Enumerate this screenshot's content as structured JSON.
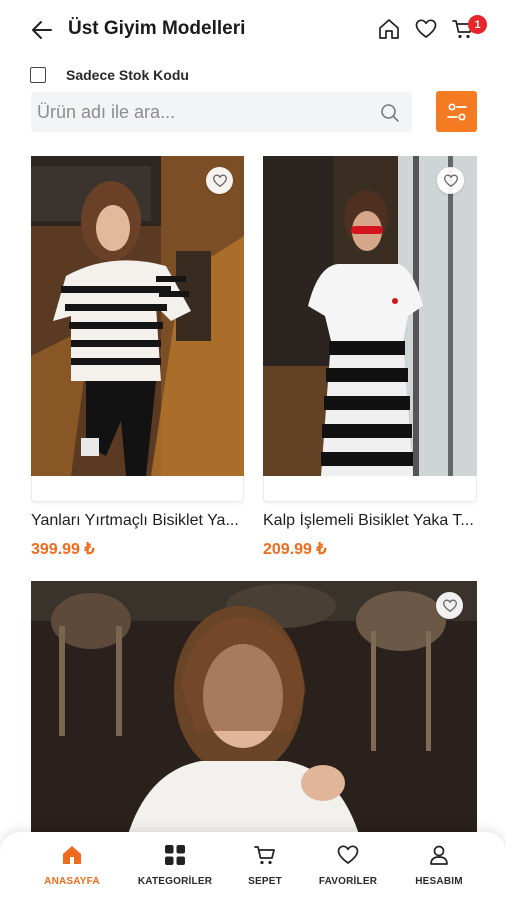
{
  "header": {
    "title": "Üst Giyim Modelleri",
    "cart_count": "1"
  },
  "filters": {
    "stock_code_label": "Sadece Stok Kodu"
  },
  "search": {
    "placeholder": "Ürün adı ile ara...",
    "value": ""
  },
  "products": [
    {
      "name": "Yanları Yırtmaçlı Bisiklet Yaka Kazak",
      "price": "399.99 ₺"
    },
    {
      "name": "Kalp İşlemeli Bisiklet Yaka Tişört",
      "price": "209.99 ₺"
    },
    {
      "name": "",
      "price": ""
    }
  ],
  "bottom_nav": {
    "items": [
      {
        "label": "ANASAYFA",
        "icon": "home-icon",
        "active": true
      },
      {
        "label": "KATEGORİLER",
        "icon": "grid-icon",
        "active": false
      },
      {
        "label": "SEPET",
        "icon": "cart-icon",
        "active": false
      },
      {
        "label": "FAVORİLER",
        "icon": "heart-icon",
        "active": false
      },
      {
        "label": "HESABIM",
        "icon": "user-icon",
        "active": false
      }
    ]
  },
  "colors": {
    "accent": "#f47b22",
    "price": "#ef6b1e",
    "badge": "#e7262c"
  }
}
